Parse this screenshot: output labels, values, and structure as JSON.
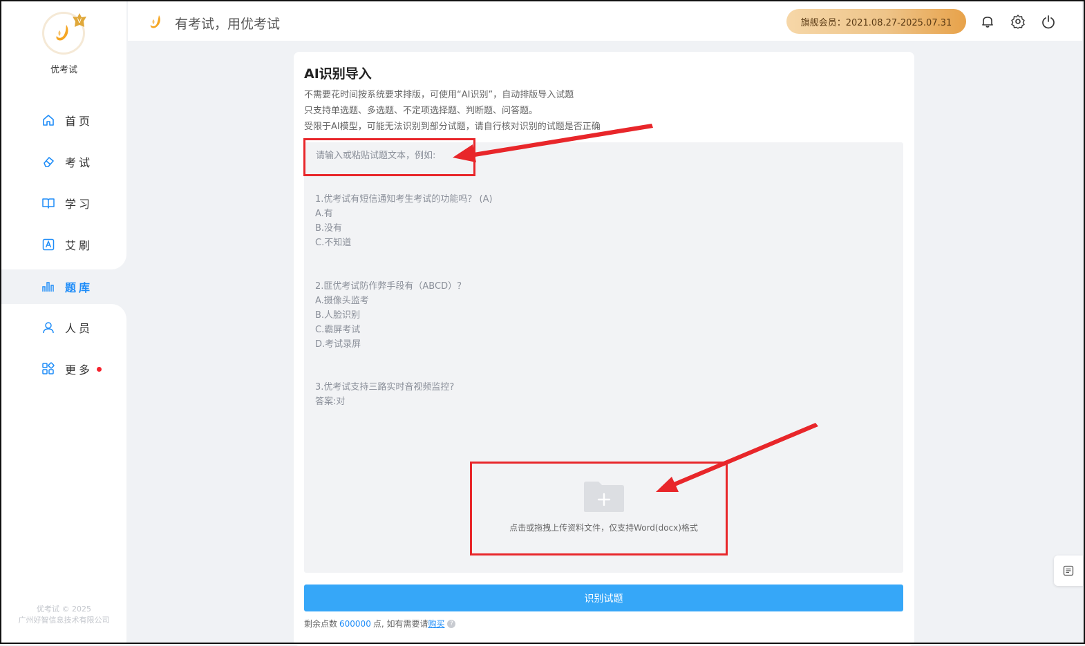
{
  "brand": {
    "name": "优考试"
  },
  "header": {
    "slogan": "有考试，用优考试",
    "vip": "旗舰会员：2021.08.27-2025.07.31"
  },
  "sidebar": {
    "items": [
      {
        "label": "首页",
        "icon": "home-icon"
      },
      {
        "label": "考试",
        "icon": "eraser-icon"
      },
      {
        "label": "学习",
        "icon": "book-icon"
      },
      {
        "label": "艾刷",
        "icon": "letter-a-icon"
      },
      {
        "label": "题库",
        "icon": "bar-chart-icon",
        "active": true
      },
      {
        "label": "人员",
        "icon": "user-icon"
      },
      {
        "label": "更多",
        "icon": "apps-icon",
        "badge_dot": true
      }
    ],
    "copyright_line1": "优考试 © 2025",
    "copyright_line2": "广州好智信息技术有限公司"
  },
  "main": {
    "title": "AI识别导入",
    "desc": [
      "不需要花时间按系统要求排版，可使用“AI识别”，自动排版导入试题",
      "只支持单选题、多选题、不定项选择题、判断题、问答题。",
      "受限于AI模型，可能无法识别到部分试题，请自行核对识别的试题是否正确"
    ],
    "placeholder": "请输入或粘贴试题文本，例如:",
    "example_lines": [
      "1.优考试有短信通知考生考试的功能吗？ (A)",
      "A.有",
      "B.没有",
      "C.不知道",
      "2.匪优考试防作弊手段有（ABCD）？",
      "A.摄像头监考",
      "B.人脸识别",
      "C.霸屏考试",
      "D.考试录屏",
      "3.优考试支持三路实时音视频监控?",
      "答案:对"
    ],
    "upload_text": "点击或拖拽上传资料文件，仅支持Word(docx)格式",
    "submit_label": "识别试题",
    "points_prefix": "剩余点数",
    "points_value": "600000",
    "points_suffix": "点, 如有需要请",
    "buy_label": "购买",
    "help_glyph": "?"
  },
  "colors": {
    "accent": "#36a7f8",
    "active": "#1d8cf8",
    "annotation": "#e8262a"
  }
}
